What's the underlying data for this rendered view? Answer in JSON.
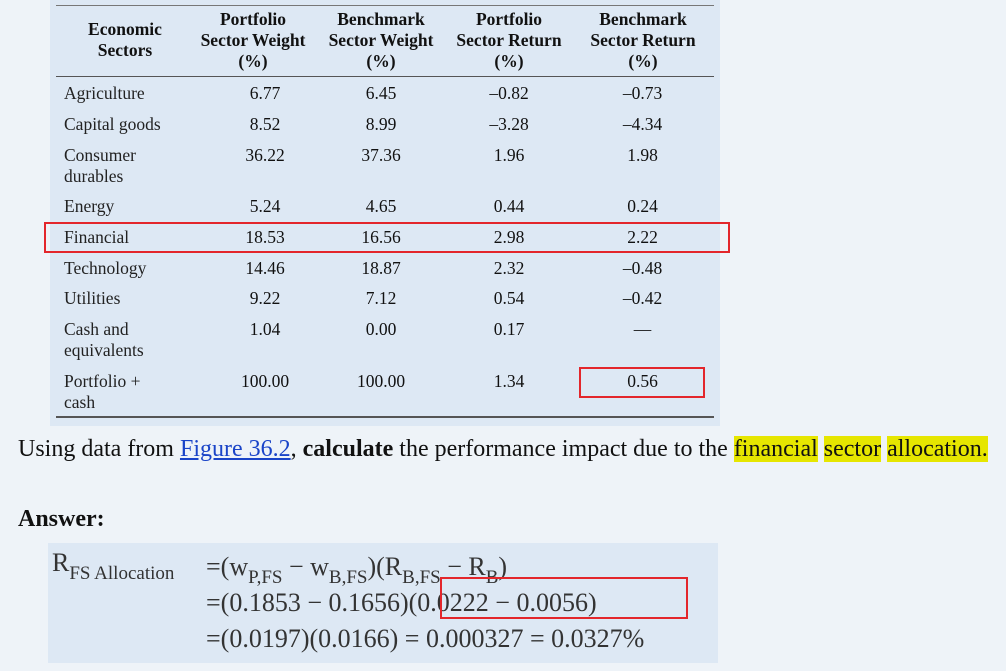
{
  "table": {
    "headers": [
      "Economic Sectors",
      "Portfolio Sector Weight (%)",
      "Benchmark Sector Weight (%)",
      "Portfolio Sector Return (%)",
      "Benchmark Sector Return (%)"
    ],
    "rows": [
      [
        "Agriculture",
        "6.77",
        "6.45",
        "–0.82",
        "–0.73"
      ],
      [
        "Capital goods",
        "8.52",
        "8.99",
        "–3.28",
        "–4.34"
      ],
      [
        "Consumer durables",
        "36.22",
        "37.36",
        "1.96",
        "1.98"
      ],
      [
        "Energy",
        "5.24",
        "4.65",
        "0.44",
        "0.24"
      ],
      [
        "Financial",
        "18.53",
        "16.56",
        "2.98",
        "2.22"
      ],
      [
        "Technology",
        "14.46",
        "18.87",
        "2.32",
        "–0.48"
      ],
      [
        "Utilities",
        "9.22",
        "7.12",
        "0.54",
        "–0.42"
      ],
      [
        "Cash and equivalents",
        "1.04",
        "0.00",
        "0.17",
        "—"
      ],
      [
        "Portfolio + cash",
        "100.00",
        "100.00",
        "1.34",
        "0.56"
      ]
    ]
  },
  "question": {
    "pre": "Using data from ",
    "link": "Figure 36.2",
    "mid": ", ",
    "bold": "calculate",
    "post": " the performance impact due to the ",
    "hl1": "financial",
    "hl2": "sector",
    "hl3": "allocation."
  },
  "answer_label": "Answer:",
  "equation": {
    "lhs": "R",
    "lhs_sub": "FS Allocation",
    "line1": "=(w",
    "line1_sub1": "P,FS",
    "line1_mid": " − w",
    "line1_sub2": "B,FS",
    "line1_mid2": ")(R",
    "line1_sub3": "B,FS",
    "line1_mid3": " − R",
    "line1_sub4": "B",
    "line1_end": ")",
    "line2": "=(0.1853 − 0.1656)(0.0222 − 0.0056)",
    "line3": "=(0.0197)(0.0166) = 0.000327 = 0.0327%"
  }
}
